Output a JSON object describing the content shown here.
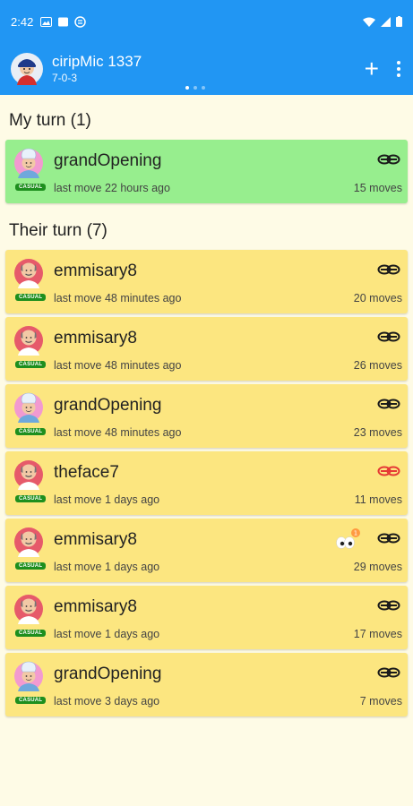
{
  "status_bar": {
    "time": "2:42"
  },
  "app_bar": {
    "title": "ciripMic 1337",
    "subtitle": "7-0-3",
    "add_label": "+"
  },
  "sections": {
    "mine_header": "My turn (1)",
    "theirs_header": "Their turn (7)"
  },
  "badge_label": "CASUAL",
  "games_mine": [
    {
      "name": "grandOpening",
      "last_move": "last move 22 hours ago",
      "moves": "15 moves"
    }
  ],
  "games_theirs": [
    {
      "name": "emmisary8",
      "last_move": "last move 48 minutes ago",
      "moves": "20 moves"
    },
    {
      "name": "emmisary8",
      "last_move": "last move 48 minutes ago",
      "moves": "26 moves"
    },
    {
      "name": "grandOpening",
      "last_move": "last move 48 minutes ago",
      "moves": "23 moves"
    },
    {
      "name": "theface7",
      "last_move": "last move 1 days ago",
      "moves": "11 moves"
    },
    {
      "name": "emmisary8",
      "last_move": "last move 1 days ago",
      "moves": "29 moves"
    },
    {
      "name": "emmisary8",
      "last_move": "last move 1 days ago",
      "moves": "17 moves"
    },
    {
      "name": "grandOpening",
      "last_move": "last move 3 days ago",
      "moves": "7 moves"
    }
  ],
  "eyes_badge_count": "1",
  "colors": {
    "app_bar": "#2196f3",
    "my_turn_card": "#97ee8e",
    "their_turn_card": "#fce680",
    "badge": "#1e8f1e",
    "link_alert": "#e53935"
  }
}
